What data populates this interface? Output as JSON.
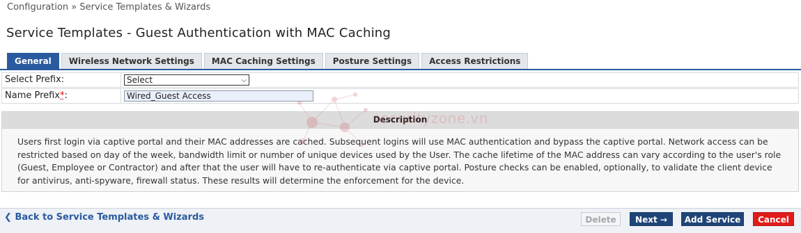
{
  "breadcrumb": "Configuration » Service Templates & Wizards",
  "title": "Service Templates - Guest Authentication with MAC Caching",
  "tabs": [
    {
      "label": "General",
      "active": true
    },
    {
      "label": "Wireless Network Settings",
      "active": false
    },
    {
      "label": "MAC Caching Settings",
      "active": false
    },
    {
      "label": "Posture Settings",
      "active": false
    },
    {
      "label": "Access Restrictions",
      "active": false
    }
  ],
  "form": {
    "select_prefix_label": "Select Prefix:",
    "select_prefix_value": "Select",
    "name_prefix_label": "Name Prefix",
    "name_prefix_required": "*",
    "name_prefix_colon": ":",
    "name_prefix_value": "Wired_Guest Access"
  },
  "description": {
    "header": "Description",
    "text": "Users first login via captive portal and their MAC addresses are cached. Subsequent logins will use MAC authentication and bypass the captive portal. Network access can be restricted based on day of the week, bandwidth limit or number of unique devices used by the User. The cache lifetime of the MAC address can vary according to the user's role (Guest, Employee or Contractor) and after that the user will have to re-authenticate via captive portal. Posture checks can be enabled, optionally, to validate the client device for antivirus, anti-spyware, firewall status. These results will determine the enforcement for the device."
  },
  "watermark": "securityzone.vn",
  "footer": {
    "back_icon": "chevron-left-icon",
    "back_label": "Back to Service Templates & Wizards",
    "delete_label": "Delete",
    "next_label": "Next →",
    "add_label": "Add Service",
    "cancel_label": "Cancel"
  },
  "colors": {
    "accent": "#2a5aa0",
    "primary_button": "#1f4578",
    "danger_button": "#e01b1b"
  }
}
